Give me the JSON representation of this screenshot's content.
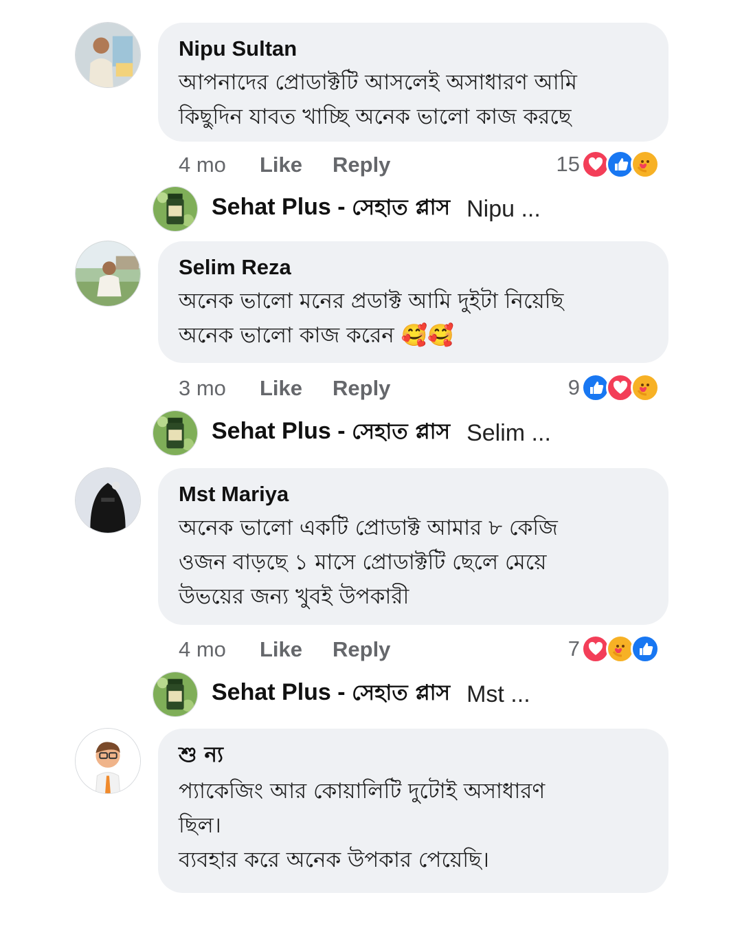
{
  "comments": [
    {
      "author": "Nipu Sultan",
      "text": "আপনাদের প্রোডাক্টটি আসলেই অসাধারণ আমি\nকিছুদিন যাবত খাচ্ছি অনেক ভালো কাজ করছে",
      "time": "4 mo",
      "like_label": "Like",
      "reply_label": "Reply",
      "reaction_count": "15",
      "reactions": [
        "love-icon",
        "like-icon",
        "care-icon"
      ],
      "page_reply": {
        "name_en": "Sehat Plus - ",
        "name_bn": "সেহাত প্লাস",
        "snippet": "Nipu ..."
      }
    },
    {
      "author": "Selim Reza",
      "text": "অনেক ভালো মনের প্রডাক্ট আমি দুইটা নিয়েছি\nঅনেক ভালো কাজ করেন 🥰🥰",
      "time": "3 mo",
      "like_label": "Like",
      "reply_label": "Reply",
      "reaction_count": "9",
      "reactions": [
        "like-icon",
        "love-icon",
        "care-icon"
      ],
      "page_reply": {
        "name_en": "Sehat Plus - ",
        "name_bn": "সেহাত প্লাস",
        "snippet": "Selim ..."
      }
    },
    {
      "author": "Mst Mariya",
      "text": "অনেক ভালো একটি প্রোডাক্ট আমার ৮ কেজি\nওজন বাড়ছে ১ মাসে  প্রোডাক্টটি ছেলে মেয়ে\nউভয়ের জন্য খুবই উপকারী",
      "time": "4 mo",
      "like_label": "Like",
      "reply_label": "Reply",
      "reaction_count": "7",
      "reactions": [
        "love-icon",
        "care-icon",
        "like-icon"
      ],
      "page_reply": {
        "name_en": "Sehat Plus - ",
        "name_bn": "সেহাত প্লাস",
        "snippet": "Mst ..."
      }
    },
    {
      "author": "শু ন্য",
      "text": "প্যাকেজিং আর কোয়ালিটি দুটোই অসাধারণ\nছিল।\nব্যবহার করে অনেক উপকার পেয়েছি।"
    }
  ],
  "colors": {
    "bubble": "#eff1f4",
    "meta": "#65676b",
    "love": "#f33e58",
    "like": "#1877f2",
    "care": "#f7b125"
  }
}
